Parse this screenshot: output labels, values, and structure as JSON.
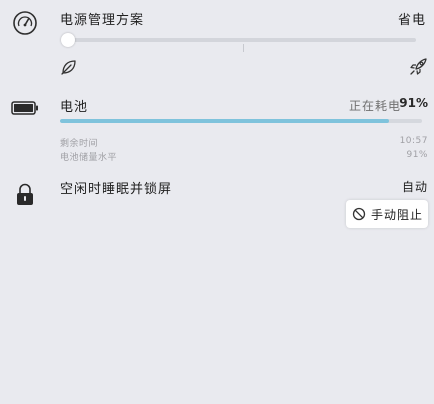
{
  "power_plan": {
    "title": "电源管理方案",
    "mode": "省电",
    "slider_value": 0,
    "left_icon": "leaf-icon",
    "right_icon": "rocket-icon"
  },
  "battery": {
    "title": "电池",
    "status": "正在耗电",
    "percent": "91%",
    "percent_value": 0.91,
    "remaining_label": "剩余时间",
    "remaining_value": "10:57",
    "reserve_label": "电池储量水平",
    "reserve_value": "91%",
    "bar_color": "#7fc3dc"
  },
  "lock": {
    "title": "空闲时睡眠并锁屏",
    "mode": "自动",
    "button_label": "手动阻止",
    "button_icon": "block-icon"
  }
}
